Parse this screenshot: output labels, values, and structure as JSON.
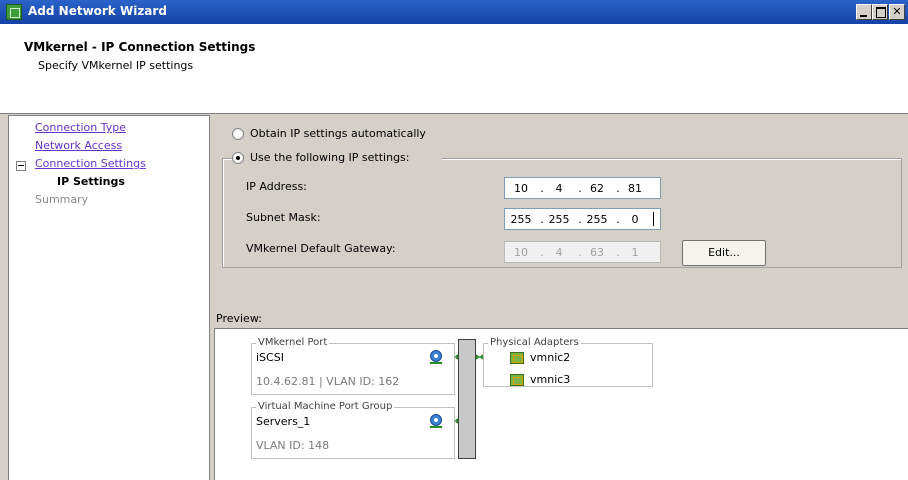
{
  "window": {
    "title": "Add Network Wizard"
  },
  "header": {
    "title": "VMkernel - IP Connection Settings",
    "subtitle": "Specify VMkernel IP settings"
  },
  "nav": {
    "items": [
      {
        "label": "Connection Type",
        "state": "link"
      },
      {
        "label": "Network Access",
        "state": "link"
      },
      {
        "label": "Connection Settings",
        "state": "link"
      },
      {
        "label": "IP Settings",
        "state": "current"
      },
      {
        "label": "Summary",
        "state": "disabled"
      }
    ]
  },
  "ip_settings": {
    "option_auto": "Obtain IP settings automatically",
    "option_manual": "Use the following IP settings:",
    "selected": "manual",
    "ip_address_label": "IP Address:",
    "ip_address": [
      "10",
      "4",
      "62",
      "81"
    ],
    "subnet_mask_label": "Subnet Mask:",
    "subnet_mask": [
      "255",
      "255",
      "255",
      "0"
    ],
    "gateway_label": "VMkernel Default Gateway:",
    "gateway": [
      "10",
      "4",
      "63",
      "1"
    ],
    "edit_button": "Edit...",
    "separator": "."
  },
  "preview": {
    "label": "Preview:",
    "vmkernel_port": {
      "caption": "VMkernel Port",
      "name": "iSCSI",
      "detail": "10.4.62.81 | VLAN ID: 162"
    },
    "vm_port_group": {
      "caption": "Virtual Machine Port Group",
      "name": "Servers_1",
      "detail": "VLAN ID: 148"
    },
    "physical_adapters": {
      "caption": "Physical Adapters",
      "adapters": [
        "vmnic2",
        "vmnic3"
      ]
    }
  },
  "colors": {
    "titlebar": "#1e50b8",
    "link": "#6633cc",
    "connector": "#2e8b2e"
  }
}
